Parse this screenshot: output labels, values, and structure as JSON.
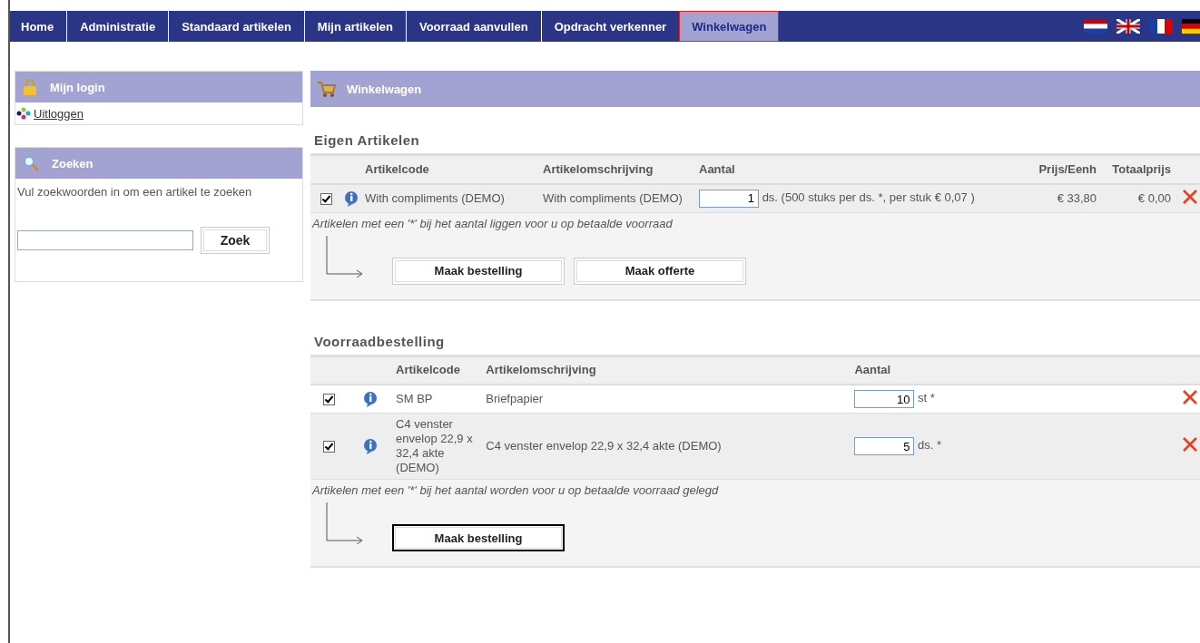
{
  "nav": [
    {
      "label": "Home",
      "selected": false
    },
    {
      "label": "Administratie",
      "selected": false
    },
    {
      "label": "Standaard artikelen",
      "selected": false
    },
    {
      "label": "Mijn artikelen",
      "selected": false
    },
    {
      "label": "Voorraad aanvullen",
      "selected": false
    },
    {
      "label": "Opdracht verkenner",
      "selected": false
    },
    {
      "label": "Winkelwagen",
      "selected": true
    }
  ],
  "login": {
    "title": "Mijn login",
    "link": "Uitloggen"
  },
  "search": {
    "title": "Zoeken",
    "hint": "Vul zoekwoorden in om een artikel te zoeken",
    "button": "Zoek"
  },
  "cart": {
    "title": "Winkelwagen"
  },
  "own": {
    "title": "Eigen Artikelen",
    "columns": [
      "Artikelcode",
      "Artikelomschrijving",
      "Aantal",
      "Prijs/Eenh",
      "Totaalprijs"
    ],
    "rows": [
      {
        "checked": true,
        "code": "With compliments (DEMO)",
        "description": "With compliments (DEMO)",
        "quantity": "1",
        "unit": "ds. (500 stuks per ds. *, per stuk € 0,07 )",
        "price": "€ 33,80",
        "total": "€ 0,00"
      }
    ],
    "note": "Artikelen met een '*' bij het aantal liggen voor u op betaalde voorraad",
    "buttons": [
      "Maak bestelling",
      "Maak offerte"
    ]
  },
  "stock": {
    "title": "Voorraadbestelling",
    "columns": [
      "Artikelcode",
      "Artikelomschrijving",
      "Aantal"
    ],
    "rows": [
      {
        "checked": true,
        "code": "SM BP",
        "description": "Briefpapier",
        "quantity": "10",
        "unit": "st *"
      },
      {
        "checked": true,
        "code": "C4 venster envelop 22,9 x 32,4 akte (DEMO)",
        "description": "C4 venster envelop 22,9 x 32,4 akte (DEMO)",
        "quantity": "5",
        "unit": "ds. *"
      }
    ],
    "note": "Artikelen met een '*' bij het aantal worden voor u op betaalde voorraad gelegd",
    "buttons": [
      "Maak bestelling"
    ]
  }
}
